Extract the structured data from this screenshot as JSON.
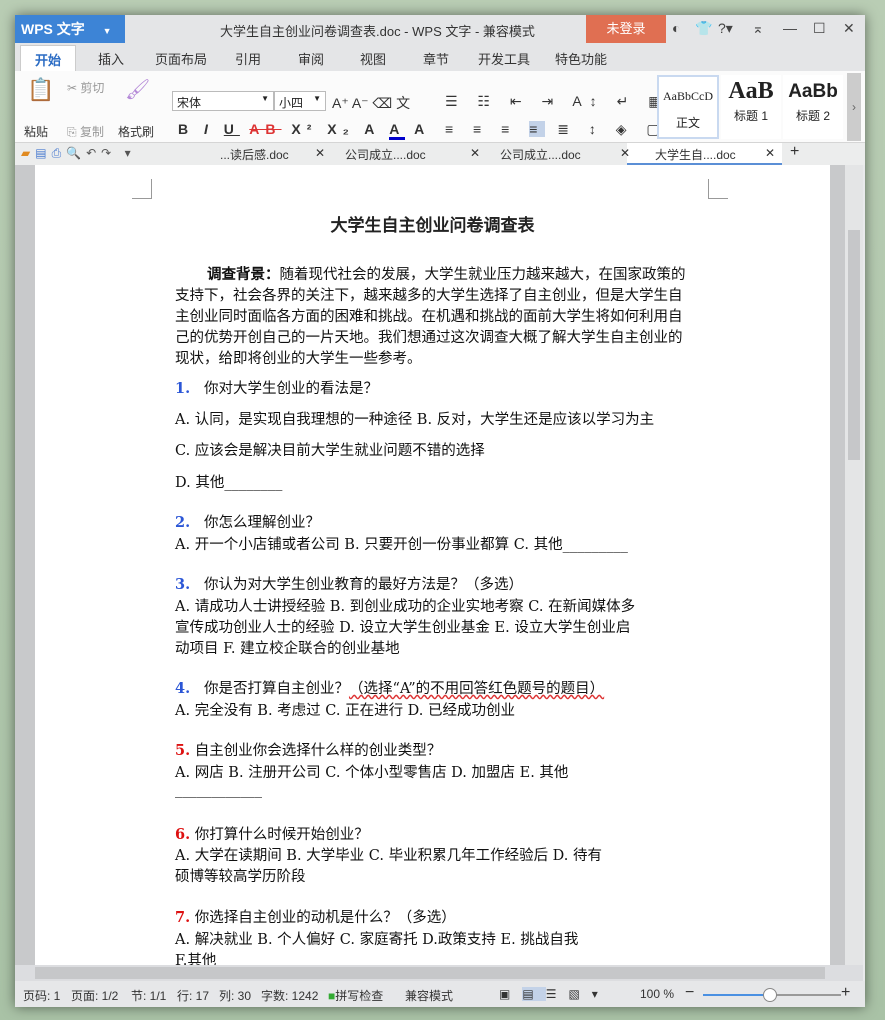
{
  "app": {
    "logo": "WPS 文字",
    "title": "大学生自主创业问卷调查表.doc - WPS 文字 - 兼容模式",
    "login": "未登录"
  },
  "menu_tabs": [
    "开始",
    "插入",
    "页面布局",
    "引用",
    "审阅",
    "视图",
    "章节",
    "开发工具",
    "特色功能"
  ],
  "ribbon": {
    "paste": "粘贴",
    "cut": "剪切",
    "copy": "复制",
    "format_painter": "格式刷",
    "font": "宋体",
    "size": "小四",
    "styles": [
      {
        "preview": "AaBbCcD",
        "name": "正文"
      },
      {
        "preview": "AaB",
        "name": "标题 1"
      },
      {
        "preview": "AaBb",
        "name": "标题 2"
      }
    ]
  },
  "doc_tabs": [
    "...读后感.doc",
    "公司成立....doc",
    "公司成立....doc",
    "大学生自....doc"
  ],
  "document": {
    "title": "大学生自主创业问卷调查表",
    "bg_label": "调查背景：",
    "bg_lines": [
      "随着现代社会的发展，大学生就业压力越来越大，在国家政策的",
      "支持下，社会各界的关注下，越来越多的大学生选择了自主创业，但是大学生自",
      "主创业同时面临各方面的困难和挑战。在机遇和挑战的面前大学生将如何利用自",
      "己的优势开创自己的一片天地。我们想通过这次调查大概了解大学生自主创业的",
      "现状，给即将创业的大学生一些参考。"
    ],
    "questions": [
      {
        "num": "1.",
        "text": "你对大学生创业的看法是？",
        "lines": [
          "A. 认同，是实现自我理想的一种途径       B. 反对，大学生还是应该以学习为主",
          "C. 应该会是解决目前大学生就业问题不错的选择",
          "D. 其他________"
        ]
      },
      {
        "num": "2.",
        "text": "你怎么理解创业？",
        "lines": [
          "A. 开一个小店铺或者公司       B. 只要开创一份事业都算       C. 其他_________"
        ]
      },
      {
        "num": "3.",
        "text": "你认为对大学生创业教育的最好方法是？（多选）",
        "lines": [
          "A. 请成功人士讲授经验     B. 到创业成功的企业实地考察      C. 在新闻媒体多",
          "宣传成功创业人士的经验     D. 设立大学生创业基金       E. 设立大学生创业启",
          "动项目      F. 建立校企联合的创业基地"
        ]
      },
      {
        "num": "4.",
        "text": "你是否打算自主创业？",
        "note": "（选择“A”的不用回答红色题号的题目）",
        "lines": [
          "A. 完全没有      B. 考虑过      C. 正在进行      D. 已经成功创业"
        ]
      },
      {
        "num": "5.",
        "text": "自主创业你会选择什么样的创业类型？",
        "lines": [
          "A. 网店      B. 注册开公司        C. 个体小型零售店        D. 加盟店        E. 其他",
          "____________"
        ]
      },
      {
        "num": "6.",
        "text": "你打算什么时候开始创业？",
        "lines": [
          "A. 大学在读期间      B. 大学毕业      C. 毕业积累几年工作经验后        D. 待有",
          "硕博等较高学历阶段"
        ]
      },
      {
        "num": "7.",
        "text": "你选择自主创业的动机是什么？（多选）",
        "lines": [
          "A. 解决就业      B. 个人偏好      C. 家庭寄托        D.政策支持      E. 挑战自我",
          "F.其他"
        ]
      }
    ]
  },
  "status": {
    "page_code": "页码: 1",
    "pages": "页面: 1/2",
    "section": "节: 1/1",
    "row": "行: 17",
    "col": "列: 30",
    "words": "字数: 1242",
    "spell": "拼写检查",
    "mode": "兼容模式",
    "zoom": "100 %",
    "zoom_percent": 100
  },
  "colors": {
    "accent": "#3d84d6",
    "login": "#e06f52",
    "question_num": "#2b56d6",
    "red_num": "#dd1111"
  }
}
